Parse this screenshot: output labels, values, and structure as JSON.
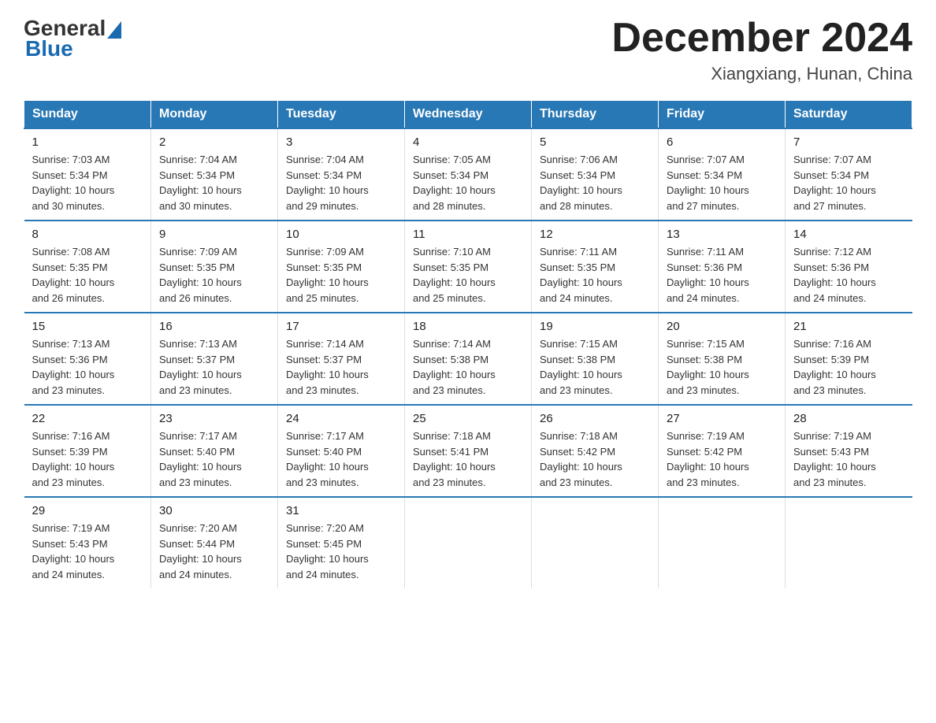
{
  "logo": {
    "general": "General",
    "blue": "Blue"
  },
  "header": {
    "month_year": "December 2024",
    "location": "Xiangxiang, Hunan, China"
  },
  "days_of_week": [
    "Sunday",
    "Monday",
    "Tuesday",
    "Wednesday",
    "Thursday",
    "Friday",
    "Saturday"
  ],
  "weeks": [
    [
      {
        "day": "1",
        "sunrise": "7:03 AM",
        "sunset": "5:34 PM",
        "daylight": "10 hours and 30 minutes."
      },
      {
        "day": "2",
        "sunrise": "7:04 AM",
        "sunset": "5:34 PM",
        "daylight": "10 hours and 30 minutes."
      },
      {
        "day": "3",
        "sunrise": "7:04 AM",
        "sunset": "5:34 PM",
        "daylight": "10 hours and 29 minutes."
      },
      {
        "day": "4",
        "sunrise": "7:05 AM",
        "sunset": "5:34 PM",
        "daylight": "10 hours and 28 minutes."
      },
      {
        "day": "5",
        "sunrise": "7:06 AM",
        "sunset": "5:34 PM",
        "daylight": "10 hours and 28 minutes."
      },
      {
        "day": "6",
        "sunrise": "7:07 AM",
        "sunset": "5:34 PM",
        "daylight": "10 hours and 27 minutes."
      },
      {
        "day": "7",
        "sunrise": "7:07 AM",
        "sunset": "5:34 PM",
        "daylight": "10 hours and 27 minutes."
      }
    ],
    [
      {
        "day": "8",
        "sunrise": "7:08 AM",
        "sunset": "5:35 PM",
        "daylight": "10 hours and 26 minutes."
      },
      {
        "day": "9",
        "sunrise": "7:09 AM",
        "sunset": "5:35 PM",
        "daylight": "10 hours and 26 minutes."
      },
      {
        "day": "10",
        "sunrise": "7:09 AM",
        "sunset": "5:35 PM",
        "daylight": "10 hours and 25 minutes."
      },
      {
        "day": "11",
        "sunrise": "7:10 AM",
        "sunset": "5:35 PM",
        "daylight": "10 hours and 25 minutes."
      },
      {
        "day": "12",
        "sunrise": "7:11 AM",
        "sunset": "5:35 PM",
        "daylight": "10 hours and 24 minutes."
      },
      {
        "day": "13",
        "sunrise": "7:11 AM",
        "sunset": "5:36 PM",
        "daylight": "10 hours and 24 minutes."
      },
      {
        "day": "14",
        "sunrise": "7:12 AM",
        "sunset": "5:36 PM",
        "daylight": "10 hours and 24 minutes."
      }
    ],
    [
      {
        "day": "15",
        "sunrise": "7:13 AM",
        "sunset": "5:36 PM",
        "daylight": "10 hours and 23 minutes."
      },
      {
        "day": "16",
        "sunrise": "7:13 AM",
        "sunset": "5:37 PM",
        "daylight": "10 hours and 23 minutes."
      },
      {
        "day": "17",
        "sunrise": "7:14 AM",
        "sunset": "5:37 PM",
        "daylight": "10 hours and 23 minutes."
      },
      {
        "day": "18",
        "sunrise": "7:14 AM",
        "sunset": "5:38 PM",
        "daylight": "10 hours and 23 minutes."
      },
      {
        "day": "19",
        "sunrise": "7:15 AM",
        "sunset": "5:38 PM",
        "daylight": "10 hours and 23 minutes."
      },
      {
        "day": "20",
        "sunrise": "7:15 AM",
        "sunset": "5:38 PM",
        "daylight": "10 hours and 23 minutes."
      },
      {
        "day": "21",
        "sunrise": "7:16 AM",
        "sunset": "5:39 PM",
        "daylight": "10 hours and 23 minutes."
      }
    ],
    [
      {
        "day": "22",
        "sunrise": "7:16 AM",
        "sunset": "5:39 PM",
        "daylight": "10 hours and 23 minutes."
      },
      {
        "day": "23",
        "sunrise": "7:17 AM",
        "sunset": "5:40 PM",
        "daylight": "10 hours and 23 minutes."
      },
      {
        "day": "24",
        "sunrise": "7:17 AM",
        "sunset": "5:40 PM",
        "daylight": "10 hours and 23 minutes."
      },
      {
        "day": "25",
        "sunrise": "7:18 AM",
        "sunset": "5:41 PM",
        "daylight": "10 hours and 23 minutes."
      },
      {
        "day": "26",
        "sunrise": "7:18 AM",
        "sunset": "5:42 PM",
        "daylight": "10 hours and 23 minutes."
      },
      {
        "day": "27",
        "sunrise": "7:19 AM",
        "sunset": "5:42 PM",
        "daylight": "10 hours and 23 minutes."
      },
      {
        "day": "28",
        "sunrise": "7:19 AM",
        "sunset": "5:43 PM",
        "daylight": "10 hours and 23 minutes."
      }
    ],
    [
      {
        "day": "29",
        "sunrise": "7:19 AM",
        "sunset": "5:43 PM",
        "daylight": "10 hours and 24 minutes."
      },
      {
        "day": "30",
        "sunrise": "7:20 AM",
        "sunset": "5:44 PM",
        "daylight": "10 hours and 24 minutes."
      },
      {
        "day": "31",
        "sunrise": "7:20 AM",
        "sunset": "5:45 PM",
        "daylight": "10 hours and 24 minutes."
      },
      null,
      null,
      null,
      null
    ]
  ],
  "labels": {
    "sunrise": "Sunrise:",
    "sunset": "Sunset:",
    "daylight": "Daylight:"
  }
}
